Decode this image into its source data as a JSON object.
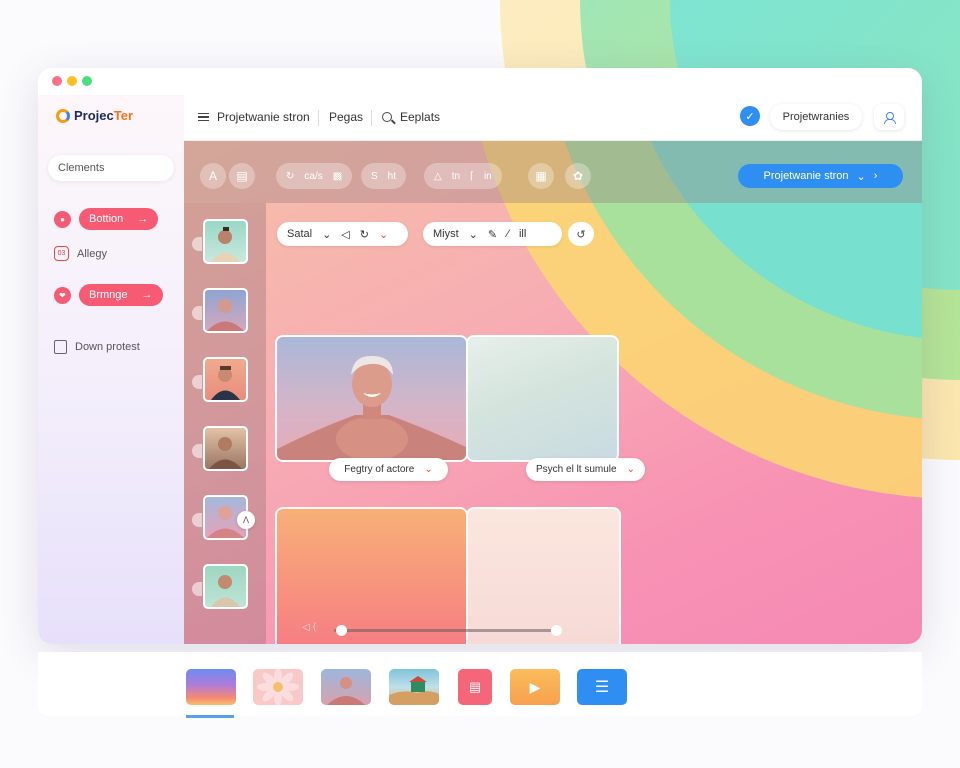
{
  "logo": {
    "text_main": "Projec",
    "text_accent": "Ter"
  },
  "sidebar": {
    "search_placeholder": "Clements",
    "items": [
      {
        "label": "Bottion",
        "icon": "bell-icon",
        "style": "pill"
      },
      {
        "label": "Allegy",
        "icon": "gallery-icon",
        "style": "text"
      },
      {
        "label": "Brmnge",
        "icon": "heart-icon",
        "style": "pill"
      },
      {
        "label": "Down protest",
        "icon": "document-icon",
        "style": "text"
      }
    ]
  },
  "topbar": {
    "items": [
      {
        "label": "Projetwanie stron",
        "icon": "menu-icon"
      },
      {
        "label": "Pegas",
        "icon": ""
      },
      {
        "label": "Eeplats",
        "icon": "search-icon"
      }
    ],
    "project_button": "Projetwranies"
  },
  "toolbar": {
    "groups": [
      {
        "labels": [
          "A"
        ]
      },
      {
        "labels": [
          "ca/s"
        ]
      },
      {
        "labels": [
          "S",
          "ht"
        ]
      },
      {
        "labels": [
          "tn",
          "in"
        ]
      }
    ],
    "primary_button": "Projetwanie stron"
  },
  "filters": {
    "bar1_label": "Satal",
    "bar2_label": "Miyst",
    "bar2_extra": "ill"
  },
  "tiles": {
    "caption1": "Fegtry of actore",
    "caption2": "Psych el lt sumule"
  },
  "player": {
    "prev": "◁ ⟨",
    "next": "⟩ ▷",
    "progress": 0.99
  },
  "colors": {
    "accent_blue": "#2e8ef2",
    "accent_pink": "#f65b73"
  }
}
